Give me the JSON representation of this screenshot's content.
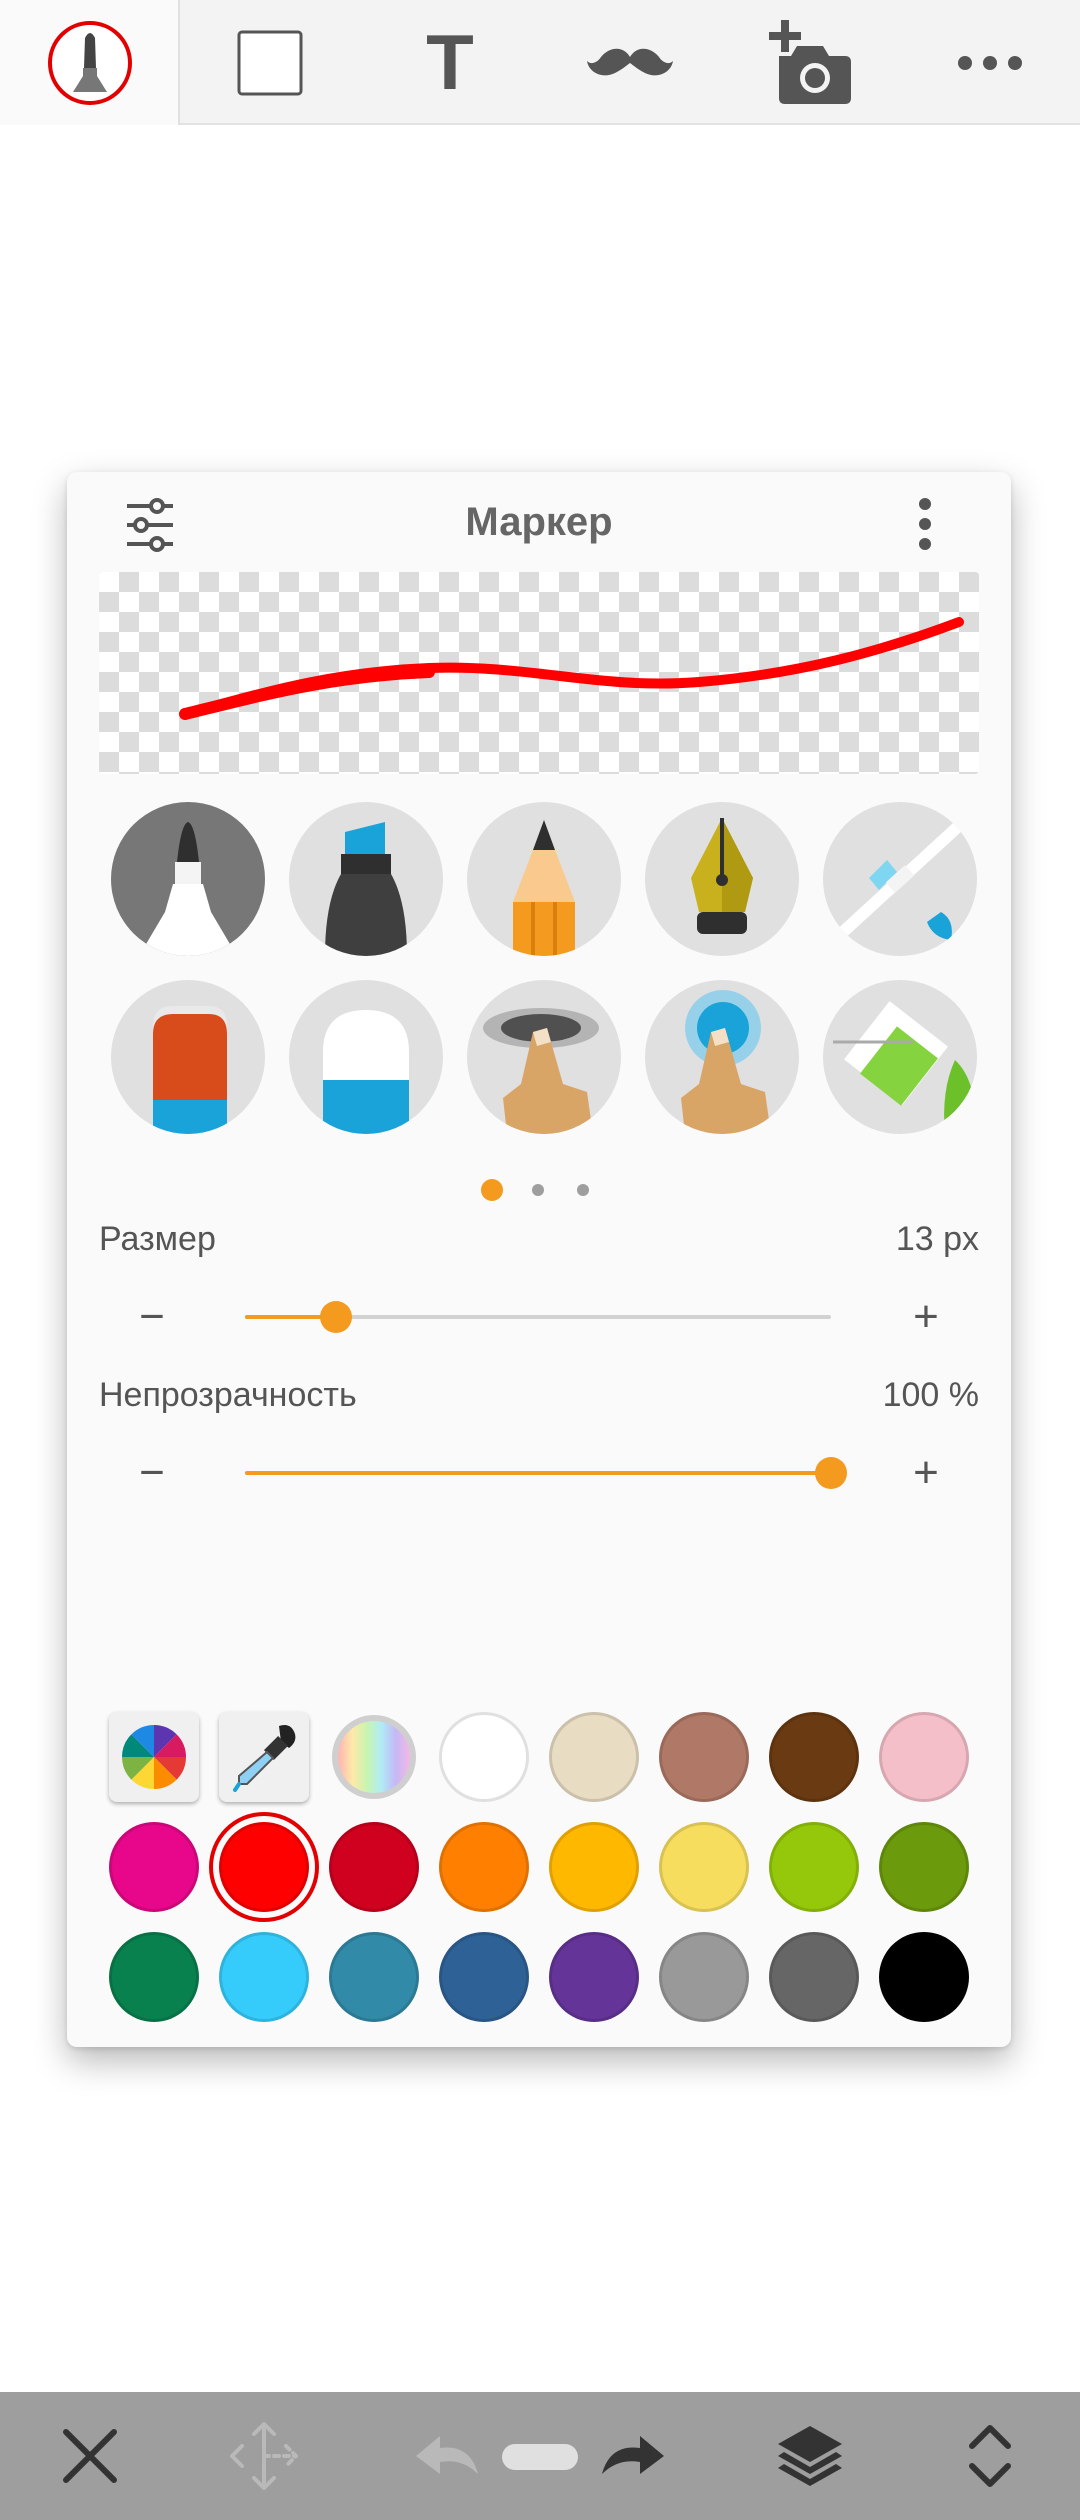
{
  "toolbar": {
    "tools": [
      {
        "name": "brush-tool",
        "icon": "marker-icon",
        "active": true
      },
      {
        "name": "shape-tool",
        "icon": "square-icon"
      },
      {
        "name": "text-tool",
        "icon": "text-icon",
        "label": "T"
      },
      {
        "name": "sticker-tool",
        "icon": "mustache-icon"
      },
      {
        "name": "photo-tool",
        "icon": "add-photo-icon"
      },
      {
        "name": "more-tool",
        "icon": "more-horizontal-icon"
      }
    ]
  },
  "panel": {
    "title": "Маркер",
    "preview_stroke_color": "#ff0000",
    "brushes": [
      {
        "name": "marker",
        "icon": "marker-brush-icon",
        "selected": true
      },
      {
        "name": "highlighter",
        "icon": "highlighter-brush-icon"
      },
      {
        "name": "pencil",
        "icon": "pencil-brush-icon"
      },
      {
        "name": "fountain-pen",
        "icon": "fountain-pen-brush-icon"
      },
      {
        "name": "airbrush",
        "icon": "airbrush-brush-icon"
      },
      {
        "name": "eraser",
        "icon": "eraser-brush-icon"
      },
      {
        "name": "soft-eraser",
        "icon": "soft-eraser-brush-icon"
      },
      {
        "name": "smudge",
        "icon": "smudge-finger-icon"
      },
      {
        "name": "blur",
        "icon": "blur-finger-icon"
      },
      {
        "name": "fill",
        "icon": "paint-fill-icon"
      }
    ],
    "page_indicator": {
      "count": 3,
      "active": 0
    },
    "size": {
      "label": "Размер",
      "value_text": "13 px",
      "fraction": 0.155,
      "minus": "−",
      "plus": "+"
    },
    "opacity": {
      "label": "Непрозрачность",
      "value_text": "100 %",
      "fraction": 1.0,
      "minus": "−",
      "plus": "+"
    },
    "palette": {
      "selected": "#ff0000",
      "rows": [
        [
          "tool:color-wheel",
          "tool:eyedropper",
          "tool:rainbow",
          "#ffffff",
          "#e8dcc3",
          "#b07866",
          "#6a3b12",
          "#f5bfca"
        ],
        [
          "#e8078a",
          "#ff0000",
          "#d0001f",
          "#ff8000",
          "#ffb800",
          "#f6dd5e",
          "#95c80a",
          "#6b9a0c"
        ],
        [
          "#08814f",
          "#35ccfb",
          "#318aa8",
          "#2e6196",
          "#653499",
          "#999999",
          "#666666",
          "#000000"
        ]
      ]
    }
  },
  "bottom_bar": {
    "icons": [
      "close-icon",
      "move-icon",
      "undo-icon",
      "redo-icon",
      "layers-icon",
      "expand-icon"
    ]
  }
}
